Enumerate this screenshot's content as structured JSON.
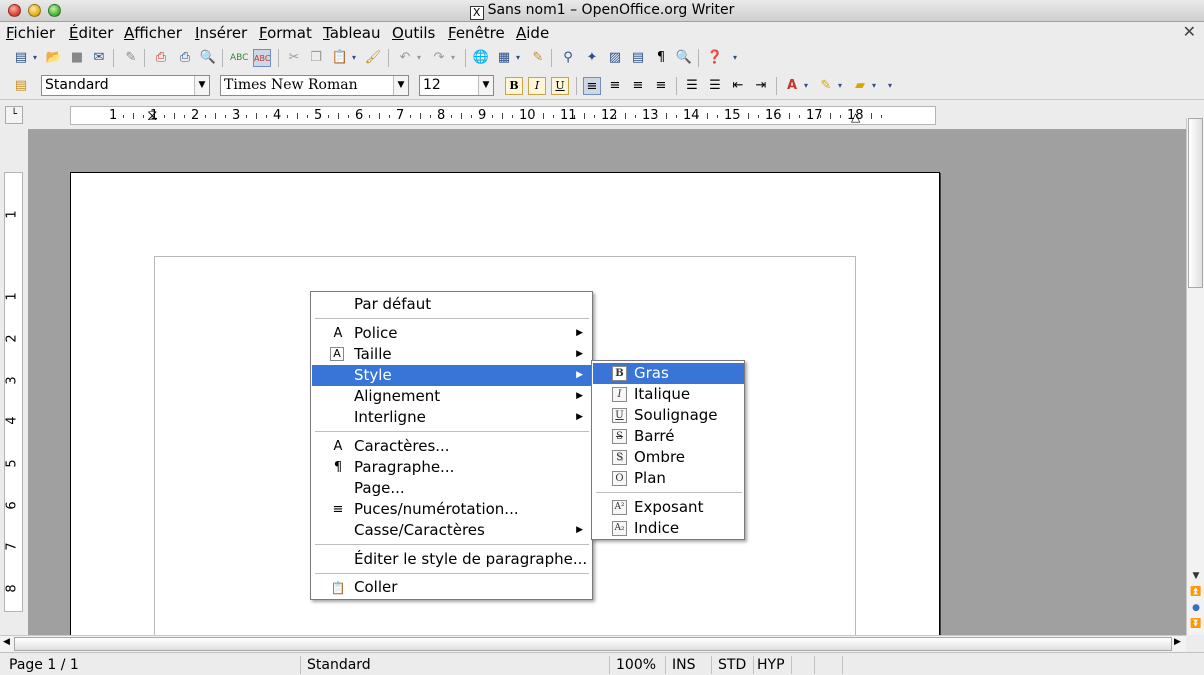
{
  "window": {
    "title": "Sans nom1 – OpenOffice.org Writer",
    "x_icon": "X"
  },
  "menubar": {
    "items": [
      {
        "label": "Fichier",
        "u": "F",
        "rest": "ichier"
      },
      {
        "label": "Éditer",
        "u": "É",
        "rest": "diter"
      },
      {
        "label": "Afficher",
        "u": "A",
        "rest": "fficher"
      },
      {
        "label": "Insérer",
        "u": "I",
        "rest": "nsérer"
      },
      {
        "label": "Format",
        "u": "F",
        "rest": "ormat"
      },
      {
        "label": "Tableau",
        "u": "T",
        "rest": "ableau"
      },
      {
        "label": "Outils",
        "u": "O",
        "rest": "utils"
      },
      {
        "label": "Fenêtre",
        "u": "F",
        "rest": "enêtre"
      },
      {
        "label": "Aide",
        "u": "A",
        "rest": "ide"
      }
    ],
    "close_glyph": "✕"
  },
  "formatting": {
    "paragraph_style": "Standard",
    "font_name": "Times New Roman",
    "font_size": "12",
    "bold": "B",
    "italic": "I",
    "underline": "U"
  },
  "ruler": {
    "h_ticks": [
      "1",
      "1",
      "2",
      "3",
      "4",
      "5",
      "6",
      "7",
      "8",
      "9",
      "10",
      "11",
      "12",
      "13",
      "14",
      "15",
      "16",
      "17",
      "18"
    ],
    "v_ticks": [
      "1",
      "1",
      "2",
      "3",
      "4",
      "5",
      "6",
      "7",
      "8"
    ]
  },
  "context_menu": {
    "items": [
      {
        "label": "Par défaut",
        "icon": ""
      },
      {
        "label": "Police",
        "icon": "A",
        "submenu": true
      },
      {
        "label": "Taille",
        "icon": "A",
        "submenu": true
      },
      {
        "label": "Style",
        "icon": "",
        "submenu": true,
        "highlighted": true
      },
      {
        "label": "Alignement",
        "icon": "",
        "submenu": true
      },
      {
        "label": "Interligne",
        "icon": "",
        "submenu": true
      },
      {
        "label": "Caractères...",
        "icon": "A"
      },
      {
        "label": "Paragraphe...",
        "icon": "¶"
      },
      {
        "label": "Page...",
        "icon": ""
      },
      {
        "label": "Puces/numérotation...",
        "icon": "≡"
      },
      {
        "label": "Casse/Caractères",
        "icon": "",
        "submenu": true
      },
      {
        "label": "Éditer le style de paragraphe...",
        "icon": ""
      },
      {
        "label": "Coller",
        "icon": "📋"
      }
    ],
    "arrow": "▶"
  },
  "style_submenu": {
    "items": [
      {
        "label": "Gras",
        "icon": "B",
        "highlighted": true
      },
      {
        "label": "Italique",
        "icon": "I"
      },
      {
        "label": "Soulignage",
        "icon": "U"
      },
      {
        "label": "Barré",
        "icon": "S"
      },
      {
        "label": "Ombre",
        "icon": "S"
      },
      {
        "label": "Plan",
        "icon": "O"
      },
      {
        "label": "Exposant",
        "icon": "A²"
      },
      {
        "label": "Indice",
        "icon": "A₂"
      }
    ]
  },
  "statusbar": {
    "page": "Page 1 / 1",
    "style": "Standard",
    "zoom": "100%",
    "insert_mode": "INS",
    "selection_mode": "STD",
    "hyphenation": "HYP"
  },
  "colors": {
    "highlight": "#3875d7",
    "doc_bg": "#a0a0a0"
  }
}
